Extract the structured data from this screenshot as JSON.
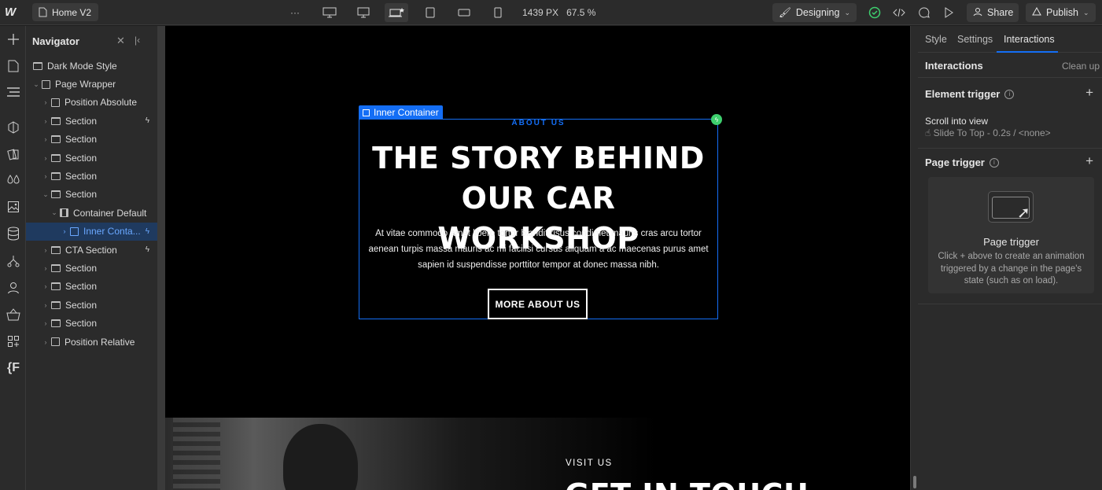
{
  "topbar": {
    "logo": "W",
    "page_name": "Home V2",
    "more": "···",
    "width_readout": "1439 PX",
    "zoom_readout": "67.5 %",
    "mode_label": "Designing",
    "share_label": "Share",
    "publish_label": "Publish"
  },
  "navigator": {
    "title": "Navigator",
    "items": [
      {
        "label": "Dark Mode Style"
      },
      {
        "label": "Page Wrapper"
      },
      {
        "label": "Position Absolute"
      },
      {
        "label": "Section"
      },
      {
        "label": "Section"
      },
      {
        "label": "Section"
      },
      {
        "label": "Section"
      },
      {
        "label": "Section"
      },
      {
        "label": "Container Default"
      },
      {
        "label": "Inner Conta..."
      },
      {
        "label": "CTA Section"
      },
      {
        "label": "Section"
      },
      {
        "label": "Section"
      },
      {
        "label": "Section"
      },
      {
        "label": "Section"
      },
      {
        "label": "Position Relative"
      }
    ]
  },
  "canvas": {
    "selected_tag": "Inner Container",
    "eyebrow": "ABOUT US",
    "headline": "THE STORY BEHIND OUR CAR WORKSHOP",
    "body": "At vitae commodo amet libero tortor blandit risus condimet mauris cras arcu tortor aenean turpis massa mauris ac mi facilisi cursus aliquam a ac maecenas purus amet sapien id suspendisse porttitor tempor at donec massa nibh.",
    "button": "MORE ABOUT US",
    "visit_label": "VISIT US",
    "next_heading": "GET IN TOUCH"
  },
  "right_panel": {
    "tabs": [
      "Style",
      "Settings",
      "Interactions"
    ],
    "title": "Interactions",
    "clean_up": "Clean up",
    "element_trigger": {
      "title": "Element trigger",
      "trigger": "Scroll into view",
      "detail": "☝ Slide To Top - 0.2s / <none>"
    },
    "page_trigger": {
      "title": "Page trigger",
      "empty_title": "Page trigger",
      "empty_desc": "Click + above to create an animation triggered by a change in the page's state (such as on load)."
    }
  },
  "colors": {
    "accent": "#146ef5",
    "success": "#3ecf6e",
    "panel": "#2b2b2b",
    "canvas": "#000000"
  },
  "icons": [
    "add-icon",
    "pages-icon",
    "navigator-icon",
    "components-icon",
    "style-selectors-icon",
    "variables-icon",
    "assets-icon",
    "cms-icon",
    "logic-icon",
    "users-icon",
    "ecommerce-icon",
    "apps-icon",
    "finsweet-icon"
  ]
}
